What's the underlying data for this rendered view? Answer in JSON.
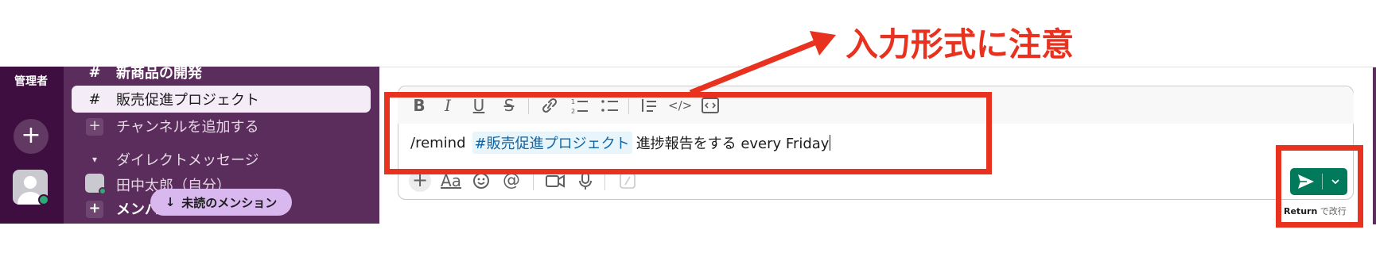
{
  "annotation": {
    "callout_text": "入力形式に注意",
    "color": "#e8311f"
  },
  "rail": {
    "label": "管理者",
    "add_icon": "plus-icon",
    "avatar_icon": "user-avatar-icon"
  },
  "sidebar": {
    "items": [
      {
        "lead": "#",
        "label": "新商品の開発",
        "icon": "hash-icon",
        "style": "bold"
      },
      {
        "lead": "#",
        "label": "販売促進プロジェクト",
        "icon": "hash-icon",
        "style": "selected"
      },
      {
        "lead": "+",
        "label": "チャンネルを追加する",
        "icon": "plus-icon",
        "style": "normal"
      },
      {
        "lead": "▾",
        "label": "ダイレクトメッセージ",
        "icon": "caret-down-icon",
        "style": "normal"
      },
      {
        "lead": "",
        "label": "田中太郎（自分）",
        "icon": "avatar-icon",
        "style": "normal"
      },
      {
        "lead": "+",
        "label": "メンバーを招待",
        "icon": "plus-icon",
        "style": "bold"
      }
    ],
    "unread_pill": {
      "arrow": "↓",
      "label": "未読のメンション"
    },
    "colors": {
      "rail": "#3f0e40",
      "sidebar": "#5b2d5c",
      "selected": "#f4ecf7"
    }
  },
  "composer": {
    "command": "/remind",
    "mention": "#販売促進プロジェクト",
    "text": "進捗報告をする every Friday",
    "format_tools": [
      "bold-icon",
      "italic-icon",
      "underline-icon",
      "strikethrough-icon",
      "link-icon",
      "ordered-list-icon",
      "bulleted-list-icon",
      "blockquote-icon",
      "code-icon",
      "code-block-icon"
    ],
    "bottom_tools": [
      "plus-icon",
      "text-format-icon",
      "emoji-icon",
      "mention-icon",
      "video-icon",
      "microphone-icon",
      "slash-command-icon"
    ],
    "format_glyphs": {
      "bold": "B",
      "italic": "I",
      "underline": "U",
      "strike": "S",
      "code": "</>"
    },
    "bottom_glyphs": {
      "plus": "+",
      "aa": "Aa",
      "mention": "@"
    },
    "send_icon": "send-icon",
    "send_menu_icon": "chevron-down-icon",
    "send_color": "#007a5a",
    "hint_key": "Return",
    "hint_text": " で改行"
  }
}
